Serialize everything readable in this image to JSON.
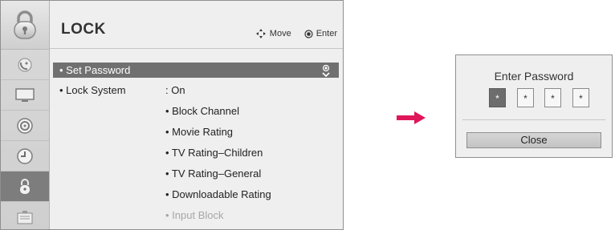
{
  "menu": {
    "title": "LOCK",
    "hint_move": "Move",
    "hint_enter": "Enter",
    "selected_item": "• Set Password",
    "lock_system_label": "• Lock System",
    "lock_system_value": ": On",
    "sub_items": [
      "• Block Channel",
      "• Movie Rating",
      "• TV Rating–Children",
      "• TV Rating–General",
      "• Downloadable Rating",
      "• Input Block"
    ],
    "sidebar_icons": [
      "lock-top-icon",
      "satellite-dish-icon",
      "monitor-icon",
      "speaker-icon",
      "clock-icon",
      "lock-icon",
      "options-icon"
    ],
    "active_sidebar": "lock-icon"
  },
  "dialog": {
    "title": "Enter Password",
    "digits": [
      "*",
      "*",
      "*",
      "*"
    ],
    "active_digit": 0,
    "close_label": "Close"
  },
  "colors": {
    "selection": "#707070",
    "arrow": "#e0165a",
    "panel": "#efefef"
  }
}
